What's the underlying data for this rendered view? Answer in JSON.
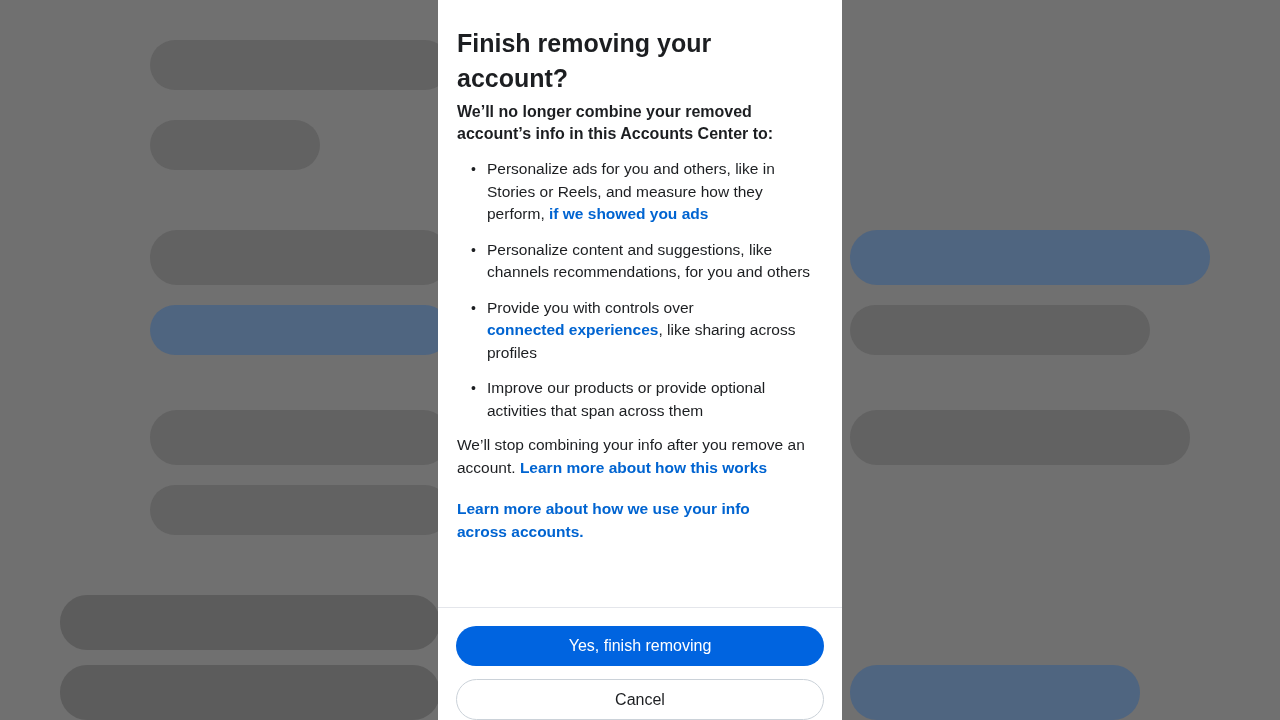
{
  "dialog": {
    "title": "Finish removing your account?",
    "intro": "We’ll no longer combine your removed account’s info in this Accounts Center to:",
    "bullets": [
      {
        "marker": "•",
        "parts": [
          {
            "text": "Personalize ads for you and others, like in Stories or Reels, and measure how they perform, ",
            "link": false
          },
          {
            "text": "if we showed you ads",
            "link": true
          }
        ]
      },
      {
        "marker": "•",
        "parts": [
          {
            "text": "Personalize content and suggestions, like channels recommendations, for you and others",
            "link": false
          }
        ]
      },
      {
        "marker": "•",
        "parts": [
          {
            "text": "Provide you with controls over ",
            "link": false
          },
          {
            "text": "connected experiences",
            "link": true
          },
          {
            "text": ", like sharing across profiles",
            "link": false
          }
        ]
      },
      {
        "marker": "•",
        "parts": [
          {
            "text": "Improve our products or provide optional activities that span across them",
            "link": false
          }
        ]
      }
    ],
    "note": [
      {
        "text": "We’ll stop combining your info after you remove an account. ",
        "link": false
      },
      {
        "text": "Learn more about how this works",
        "link": true
      }
    ],
    "info_link": "Learn more about how we use your info across accounts.",
    "buttons": [
      {
        "label": "Yes, finish removing",
        "kind": "primary"
      },
      {
        "label": "Cancel",
        "kind": "secondary"
      }
    ]
  }
}
